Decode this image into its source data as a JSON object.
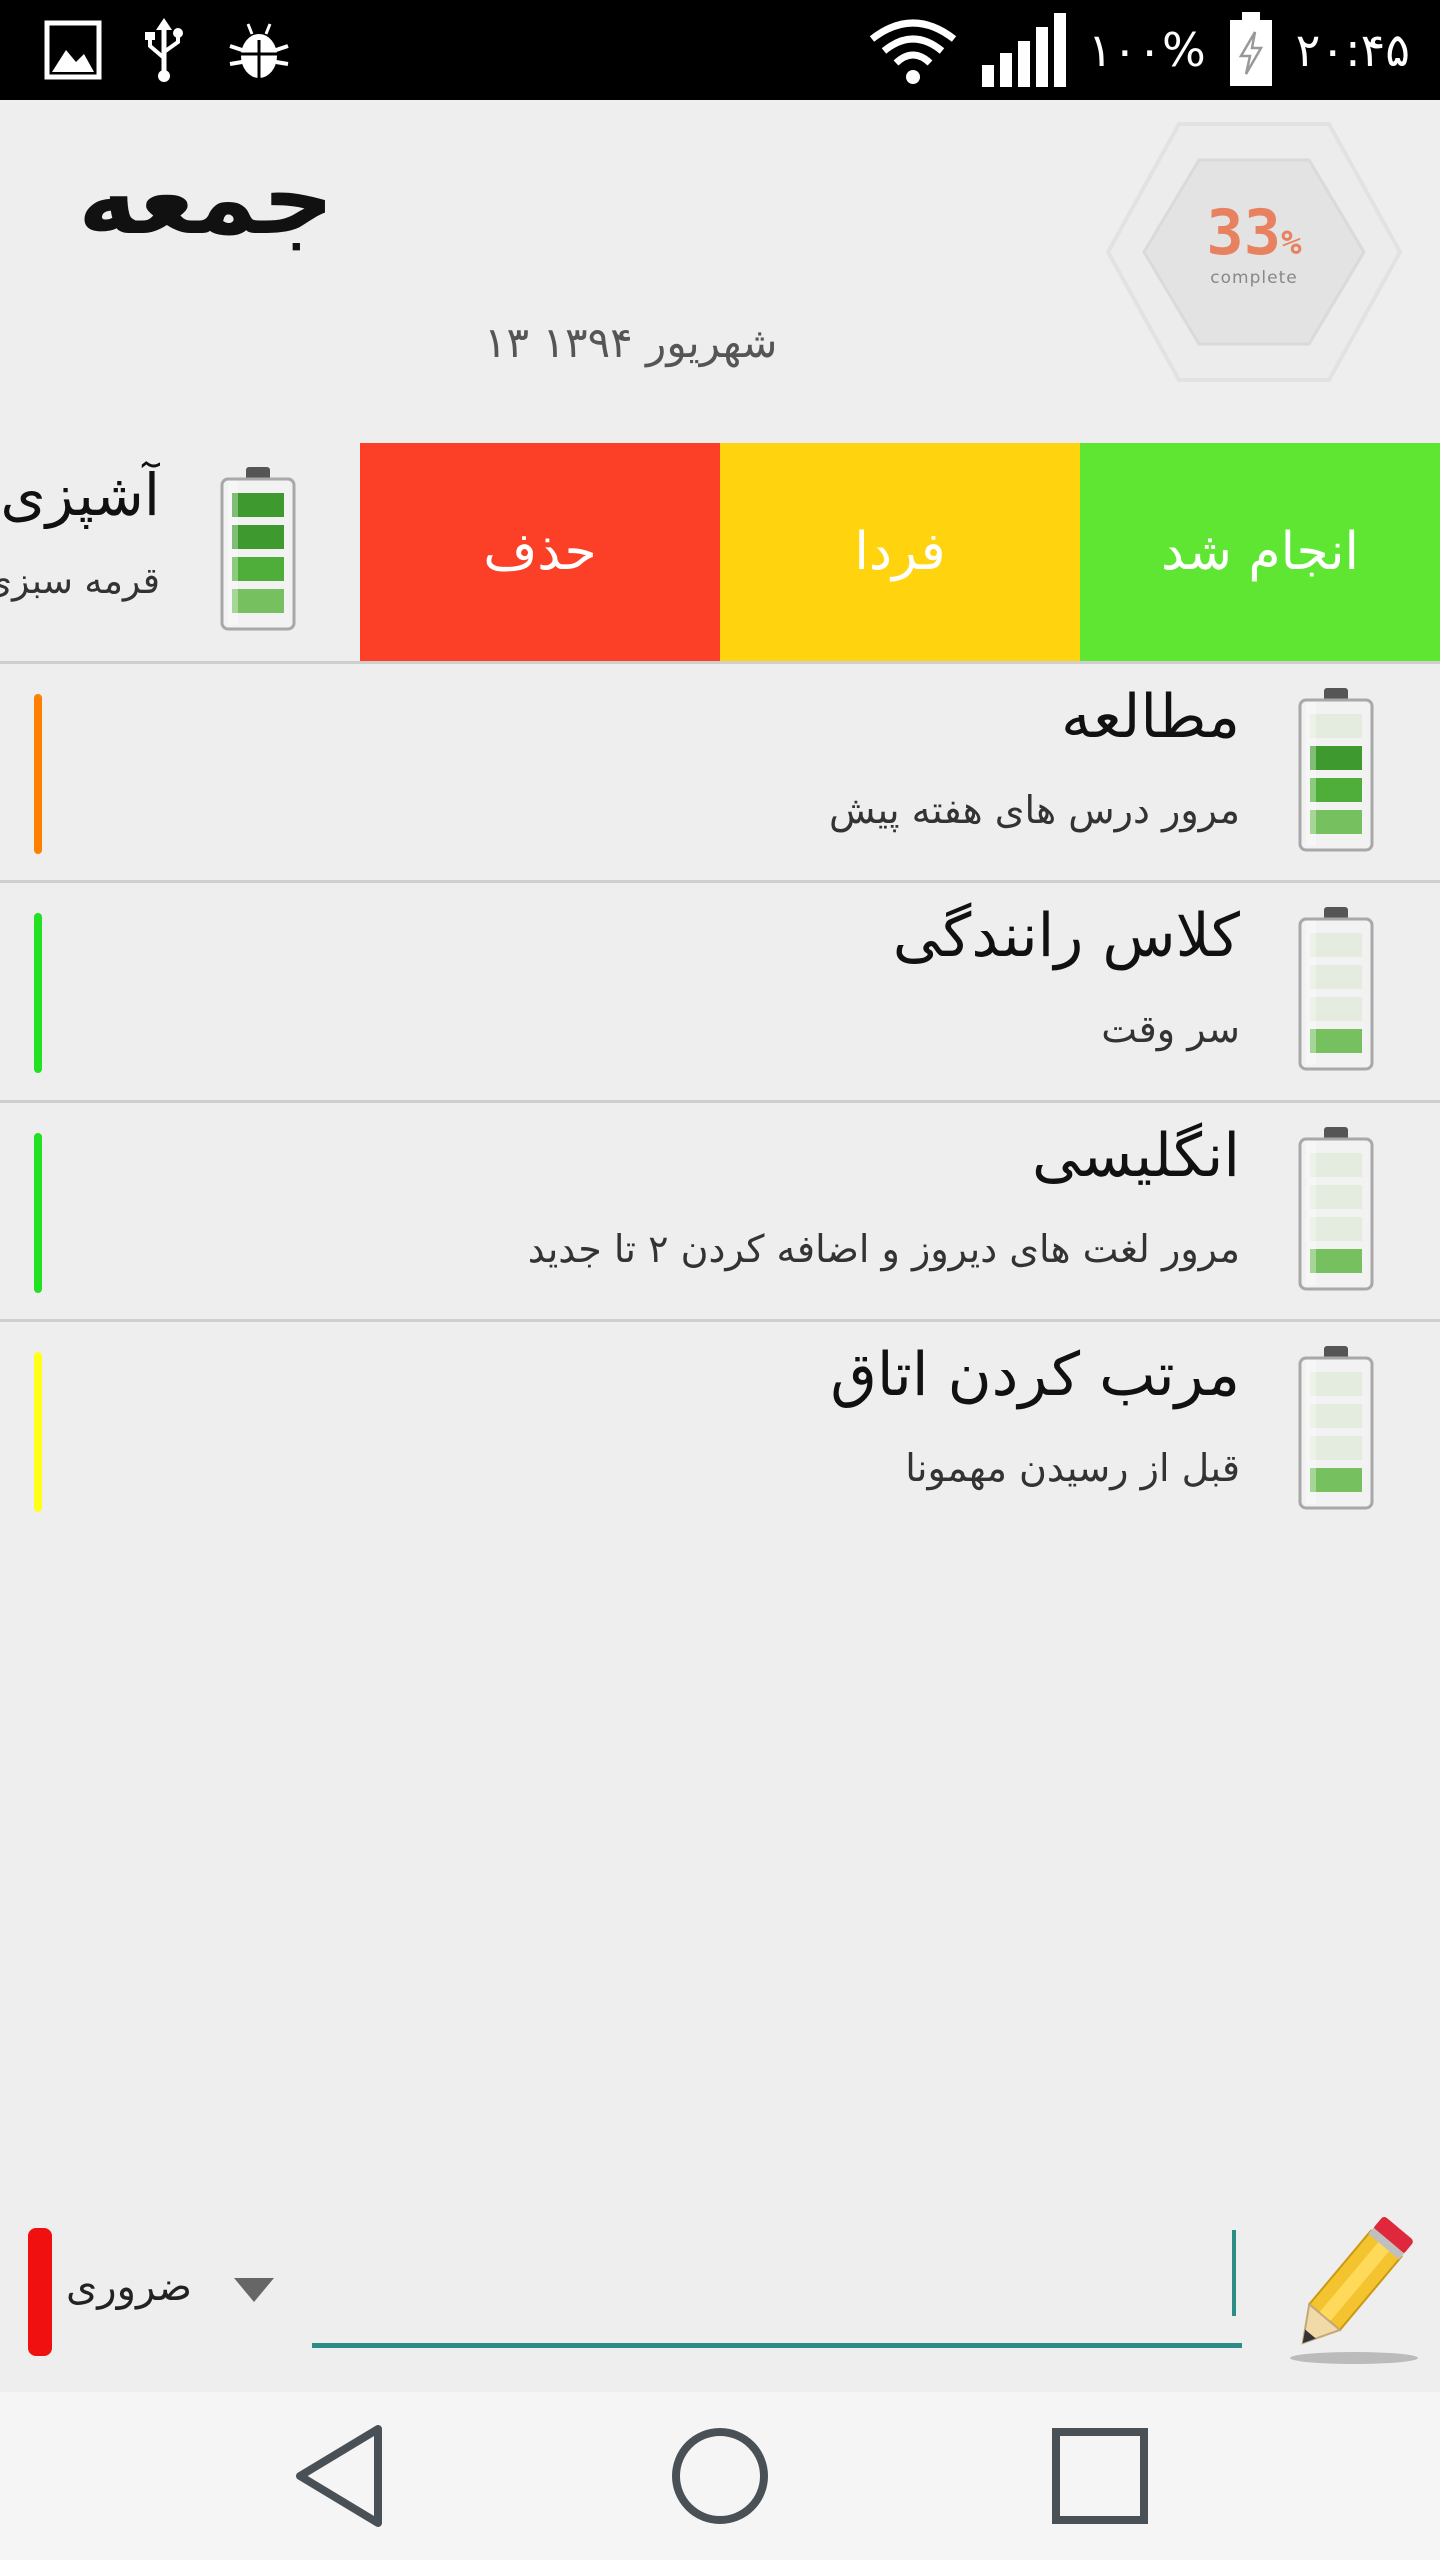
{
  "status_bar": {
    "time": "۲۰:۴۵",
    "battery_percent": "۱۰۰%",
    "icons": [
      "image-icon",
      "usb-icon",
      "android-debug-icon",
      "wifi-icon",
      "signal-icon",
      "battery-charging-icon"
    ]
  },
  "header": {
    "day": "جمعه",
    "date": "۱۳ شهریور ۱۳۹۴",
    "progress_value": "33",
    "progress_unit": "%",
    "progress_label": "complete"
  },
  "swiped_task": {
    "title": "آشپزی",
    "subtitle": "قرمه سبزی",
    "battery_level": 4,
    "actions": {
      "delete": "حذف",
      "tomorrow": "فردا",
      "done": "انجام شد"
    }
  },
  "tasks": [
    {
      "title": "مطالعه",
      "subtitle": "مرور درس های هفته پیش",
      "color": "#ff7f00",
      "battery_level": 3
    },
    {
      "title": "کلاس رانندگی",
      "subtitle": "سر وقت",
      "color": "#22e022",
      "battery_level": 1
    },
    {
      "title": "انگلیسی",
      "subtitle": "مرور لغت های دیروز و اضافه کردن ۲ تا جدید",
      "color": "#22e022",
      "battery_level": 1
    },
    {
      "title": "مرتب کردن اتاق",
      "subtitle": "قبل از رسیدن مهمونا",
      "color": "#ffff1a",
      "battery_level": 1
    }
  ],
  "input_bar": {
    "priority": "ضروری",
    "priority_color": "#f01010",
    "input_value": ""
  },
  "colors": {
    "delete": "#fb4027",
    "tomorrow": "#ffd40f",
    "done": "#5ee632",
    "accent": "#2c8d86",
    "progress": "#e8815f"
  }
}
